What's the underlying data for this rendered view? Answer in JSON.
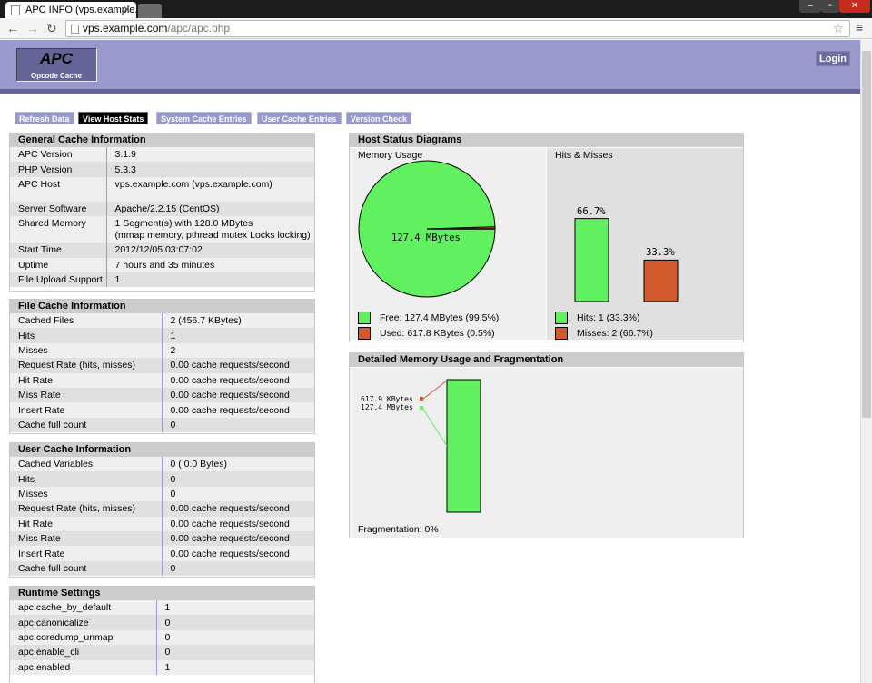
{
  "browser": {
    "tab_title": "APC INFO (vps.example.co",
    "url_host": "vps.example.com",
    "url_path": "/apc/apc.php"
  },
  "header": {
    "logo_title": "APC",
    "logo_subtitle": "Opcode Cache",
    "login_label": "Login"
  },
  "menu": [
    {
      "label": "Refresh Data"
    },
    {
      "label": "View Host Stats"
    },
    {
      "label": "System Cache Entries"
    },
    {
      "label": "User Cache Entries"
    },
    {
      "label": "Version Check"
    }
  ],
  "general": {
    "title": "General Cache Information",
    "rows": [
      {
        "k": "APC Version",
        "v": "3.1.9"
      },
      {
        "k": "PHP Version",
        "v": "5.3.3"
      },
      {
        "k": "APC Host",
        "v": "vps.example.com (vps.example.com)"
      },
      {
        "k": "Server Software",
        "v": "Apache/2.2.15 (CentOS)"
      },
      {
        "k": "Shared Memory",
        "v": "1 Segment(s) with 128.0 MBytes",
        "v2": "(mmap memory, pthread mutex Locks locking)"
      },
      {
        "k": "Start Time",
        "v": "2012/12/05 03:07:02"
      },
      {
        "k": "Uptime",
        "v": "7 hours and 35 minutes"
      },
      {
        "k": "File Upload Support",
        "v": "1"
      }
    ]
  },
  "file_cache": {
    "title": "File Cache Information",
    "rows": [
      {
        "k": "Cached Files",
        "v": "2 (456.7 KBytes)"
      },
      {
        "k": "Hits",
        "v": "1"
      },
      {
        "k": "Misses",
        "v": "2"
      },
      {
        "k": "Request Rate (hits, misses)",
        "v": "0.00 cache requests/second"
      },
      {
        "k": "Hit Rate",
        "v": "0.00 cache requests/second"
      },
      {
        "k": "Miss Rate",
        "v": "0.00 cache requests/second"
      },
      {
        "k": "Insert Rate",
        "v": "0.00 cache requests/second"
      },
      {
        "k": "Cache full count",
        "v": "0"
      }
    ]
  },
  "user_cache": {
    "title": "User Cache Information",
    "rows": [
      {
        "k": "Cached Variables",
        "v": "0 ( 0.0 Bytes)"
      },
      {
        "k": "Hits",
        "v": "0"
      },
      {
        "k": "Misses",
        "v": "0"
      },
      {
        "k": "Request Rate (hits, misses)",
        "v": "0.00 cache requests/second"
      },
      {
        "k": "Hit Rate",
        "v": "0.00 cache requests/second"
      },
      {
        "k": "Miss Rate",
        "v": "0.00 cache requests/second"
      },
      {
        "k": "Insert Rate",
        "v": "0.00 cache requests/second"
      },
      {
        "k": "Cache full count",
        "v": "0"
      }
    ]
  },
  "runtime": {
    "title": "Runtime Settings",
    "rows": [
      {
        "k": "apc.cache_by_default",
        "v": "1"
      },
      {
        "k": "apc.canonicalize",
        "v": "0"
      },
      {
        "k": "apc.coredump_unmap",
        "v": "0"
      },
      {
        "k": "apc.enable_cli",
        "v": "0"
      },
      {
        "k": "apc.enabled",
        "v": "1"
      }
    ]
  },
  "host_status": {
    "title": "Host Status Diagrams",
    "memory_label": "Memory Usage",
    "hits_label": "Hits & Misses",
    "pie_label": "127.4 MBytes",
    "legend_free": "Free: 127.4 MBytes (99.5%)",
    "legend_used": "Used: 617.8 KBytes (0.5%)",
    "legend_hits": "Hits: 1 (33.3%)",
    "legend_misses": "Misses: 2 (66.7%)",
    "bar_left_label": "66.7%",
    "bar_right_label": "33.3%"
  },
  "fragmentation": {
    "title": "Detailed Memory Usage and Fragmentation",
    "label_used": "617.9 KBytes",
    "label_free": "127.4 MBytes",
    "footer": "Fragmentation: 0%"
  },
  "chart_data": [
    {
      "type": "pie",
      "title": "Memory Usage",
      "categories": [
        "Free",
        "Used"
      ],
      "values": [
        99.5,
        0.5
      ]
    },
    {
      "type": "bar",
      "title": "Hits & Misses",
      "categories": [
        "Hits",
        "Misses"
      ],
      "values": [
        66.7,
        33.3
      ],
      "ylim": [
        0,
        100
      ]
    }
  ],
  "colors": {
    "green": "#60f060",
    "orange": "#d05a2c",
    "header": "#9999cc"
  }
}
